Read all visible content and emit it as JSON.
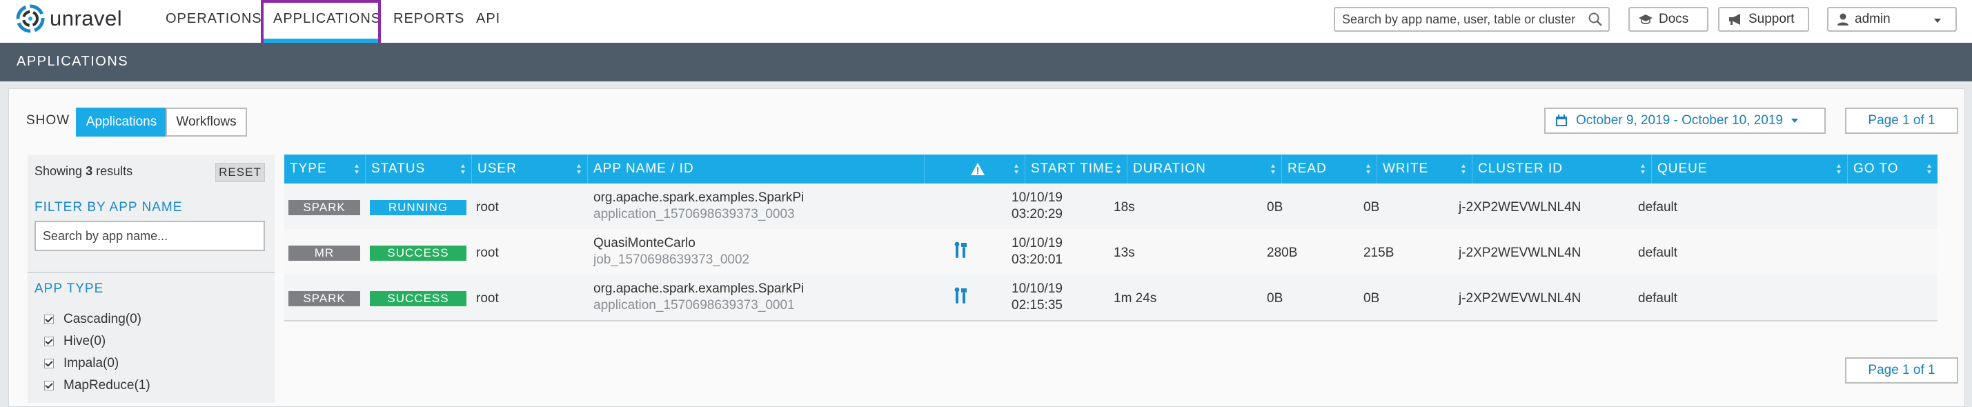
{
  "brand": {
    "name": "unravel"
  },
  "nav": {
    "items": [
      {
        "label": "OPERATIONS"
      },
      {
        "label": "APPLICATIONS"
      },
      {
        "label": "REPORTS"
      },
      {
        "label": "API"
      }
    ],
    "active": "APPLICATIONS"
  },
  "search": {
    "placeholder": "Search by app name, user, table or cluster"
  },
  "buttons": {
    "docs": "Docs",
    "support": "Support",
    "user": "admin"
  },
  "page_title": "APPLICATIONS",
  "show": {
    "label": "SHOW",
    "options": [
      {
        "label": "Applications"
      },
      {
        "label": "Workflows"
      }
    ],
    "selected": "Applications"
  },
  "date_range": "October 9, 2019 - October 10, 2019",
  "pagination": {
    "label": "Page 1 of 1"
  },
  "filter": {
    "showing_prefix": "Showing",
    "count": "3",
    "showing_suffix": "results",
    "reset_label": "RESET",
    "by_name_title": "FILTER BY APP NAME",
    "name_placeholder": "Search by app name...",
    "app_type_title": "APP TYPE",
    "app_types": [
      {
        "label": "Cascading(0)",
        "checked": true
      },
      {
        "label": "Hive(0)",
        "checked": true
      },
      {
        "label": "Impala(0)",
        "checked": true
      },
      {
        "label": "MapReduce(1)",
        "checked": true
      }
    ]
  },
  "table": {
    "columns": [
      "TYPE",
      "STATUS",
      "USER",
      "APP NAME / ID",
      "",
      "START TIME",
      "DURATION",
      "READ",
      "WRITE",
      "CLUSTER ID",
      "QUEUE",
      "GO TO"
    ],
    "rows": [
      {
        "type": "SPARK",
        "status": "RUNNING",
        "user": "root",
        "app_name": "org.apache.spark.examples.SparkPi",
        "app_id": "application_1570698639373_0003",
        "start_date": "10/10/19",
        "start_time": "03:20:29",
        "duration": "18s",
        "read": "0B",
        "write": "0B",
        "cluster_id": "j-2XP2WEVWLNL4N",
        "queue": "default",
        "has_tool_icon": false
      },
      {
        "type": "MR",
        "status": "SUCCESS",
        "user": "root",
        "app_name": "QuasiMonteCarlo",
        "app_id": "job_1570698639373_0002",
        "start_date": "10/10/19",
        "start_time": "03:20:01",
        "duration": "13s",
        "read": "280B",
        "write": "215B",
        "cluster_id": "j-2XP2WEVWLNL4N",
        "queue": "default",
        "has_tool_icon": true
      },
      {
        "type": "SPARK",
        "status": "SUCCESS",
        "user": "root",
        "app_name": "org.apache.spark.examples.SparkPi",
        "app_id": "application_1570698639373_0001",
        "start_date": "10/10/19",
        "start_time": "02:15:35",
        "duration": "1m 24s",
        "read": "0B",
        "write": "0B",
        "cluster_id": "j-2XP2WEVWLNL4N",
        "queue": "default",
        "has_tool_icon": true
      }
    ]
  },
  "colors": {
    "accent": "#1aabe6",
    "header_bar": "#4e5b68",
    "running": "#1aabe6",
    "success": "#27ae60",
    "type_badge": "#7d7f82",
    "highlight_border": "#8a2aa5"
  }
}
